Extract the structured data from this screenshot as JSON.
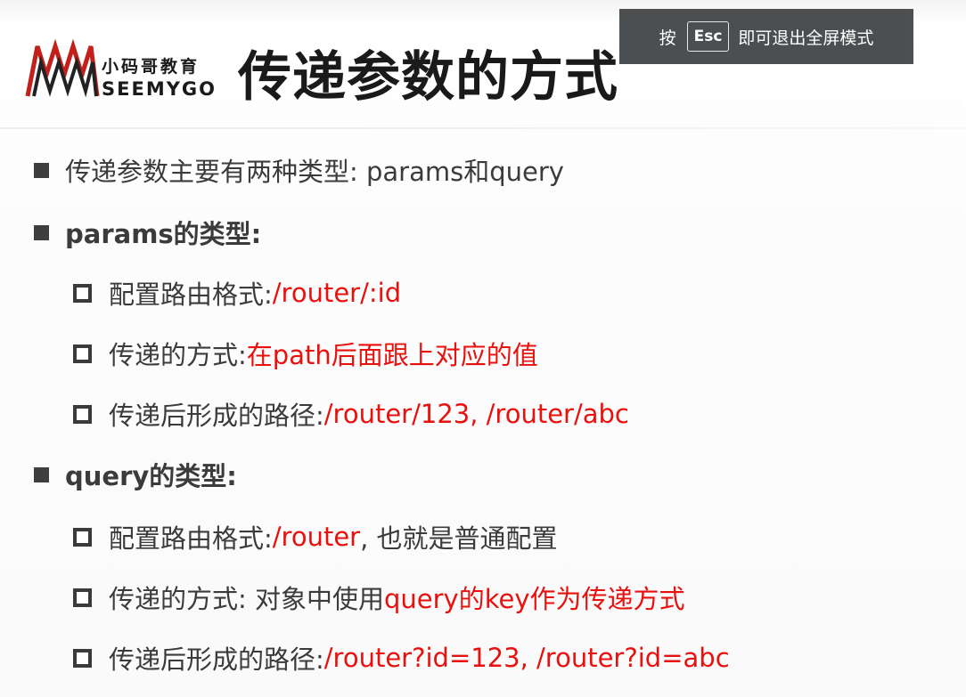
{
  "esc_banner": {
    "prefix": "按",
    "key": "Esc",
    "suffix": "即可退出全屏模式"
  },
  "logo": {
    "cn": "小码哥教育",
    "en": "SEEMYGO"
  },
  "slide": {
    "title": "传递参数的方式",
    "items": [
      {
        "text": "传递参数主要有两种类型: params和query"
      },
      {
        "text": "params的类型:"
      },
      {
        "label": "配置路由格式: ",
        "value": "/router/:id"
      },
      {
        "label": "传递的方式: ",
        "value": "在path后面跟上对应的值"
      },
      {
        "label": "传递后形成的路径: ",
        "value": "/router/123, /router/abc"
      },
      {
        "text": "query的类型:"
      },
      {
        "label": "配置路由格式: ",
        "value": "/router",
        "rest": ", 也就是普通配置"
      },
      {
        "label": "传递的方式: 对象中使用",
        "value": "query的key作为传递方式"
      },
      {
        "label": "传递后形成的路径: ",
        "value": "/router?id=123, /router?id=abc"
      }
    ]
  },
  "colors": {
    "accent_red": "#e8110e",
    "text": "#3b3b3b",
    "banner_bg": "#3f4244"
  }
}
